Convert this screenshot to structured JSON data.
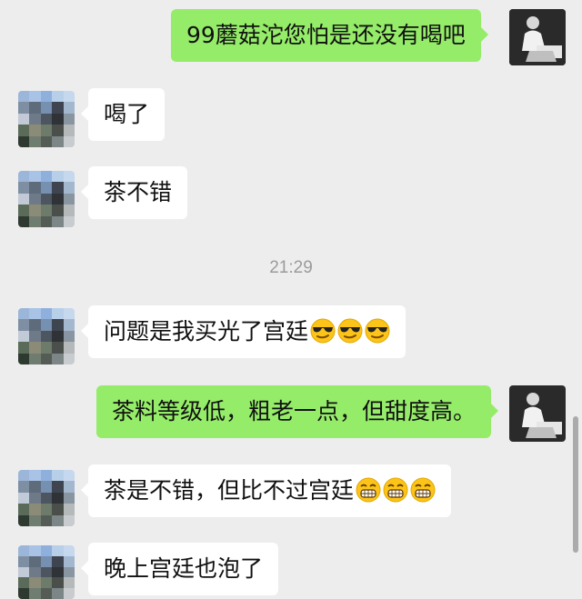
{
  "messages": [
    {
      "side": "out",
      "text": "99蘑菇沱您怕是还没有喝吧",
      "emojis": []
    },
    {
      "side": "in",
      "text": "喝了",
      "emojis": []
    },
    {
      "side": "in",
      "text": "茶不错",
      "emojis": []
    },
    {
      "side": "in",
      "text": "问题是我买光了宫廷",
      "emojis": [
        "sunglasses-emoji",
        "sunglasses-emoji",
        "sunglasses-emoji"
      ]
    },
    {
      "side": "out",
      "text": "茶料等级低，粗老一点，但甜度高。",
      "emojis": []
    },
    {
      "side": "in",
      "text": "茶是不错，但比不过宫廷",
      "emojis": [
        "grin-emoji",
        "grin-emoji",
        "grin-emoji"
      ]
    },
    {
      "side": "in",
      "text": "晚上宫廷也泡了",
      "emojis": []
    }
  ],
  "timestamp": "21:29",
  "colors": {
    "background": "#ededed",
    "outgoing_bubble": "#95ec69",
    "incoming_bubble": "#ffffff",
    "timestamp_text": "#9b9b9b"
  }
}
